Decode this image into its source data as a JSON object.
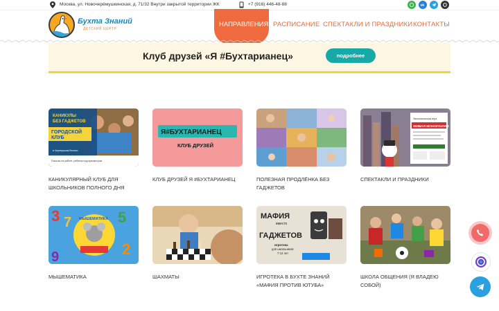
{
  "topbar": {
    "address": "Москва, ул. Новочерёмушкинская, д. 71/32 Внутри закрытой территории ЖК",
    "phone": "+7 (916) 446-48-88",
    "social": [
      {
        "icon": "whatsapp-icon",
        "color": "#3fb44a"
      },
      {
        "icon": "vk-icon",
        "color": "#2a7fd4"
      },
      {
        "icon": "telegram-icon",
        "color": "#2aa0de"
      },
      {
        "icon": "max-icon",
        "color": "#333333"
      }
    ]
  },
  "logo": {
    "title": "Бухта Знаний",
    "subtitle": "ДЕТСКИЙ ЦЕНТР"
  },
  "nav": {
    "items": [
      {
        "label": "НАПРАВЛЕНИЯ",
        "active": true
      },
      {
        "label": "РАСПИСАНИЕ",
        "active": false
      },
      {
        "label": "СПЕКТАКЛИ И ПРАЗДНИКИ",
        "active": false
      },
      {
        "label": "КОНТАКТЫ",
        "active": false
      }
    ],
    "accent_color": "#ef6a3e"
  },
  "banner": {
    "title": "Клуб друзей «Я #Бухтарианец»",
    "button_label": "подробнее"
  },
  "cards": [
    {
      "caption": "КАНИКУЛЯРНЫЙ КЛУБ ДЛЯ ШКОЛЬНИКОВ ПОЛНОГО ДНЯ",
      "thumb": {
        "line1": "КАНИКУЛЫ",
        "line2": "БЕЗ ГАДЖЕТОВ",
        "line3": "ГОРОДСКОЙ",
        "line4": "КЛУБ",
        "tag": "в Черемушках/Зюзино",
        "note": "Пока вы на работе, ребенок под присмотром"
      }
    },
    {
      "caption": "КЛУБ ДРУЗЕЙ Я #БУХТАРИАНЕЦ",
      "thumb": {
        "line1": "Я#БУХТАРИАНЕЦ",
        "line2": "КЛУБ ДРУЗЕЙ"
      }
    },
    {
      "caption": "ПОЛЕЗНАЯ ПРОДЛЁНКА БЕЗ ГАДЖЕТОВ",
      "thumb": {}
    },
    {
      "caption": "СПЕКТАКЛИ И ПРАЗДНИКИ",
      "thumb": {
        "line1": "Экономическая игра",
        "line2": "ЖИВАЯ МОНОПОЛИЯ"
      }
    },
    {
      "caption": "МЫШЕМАТИКА",
      "thumb": {
        "line1": "МЫШЕМАТИКА"
      }
    },
    {
      "caption": "ШАХМАТЫ",
      "thumb": {}
    },
    {
      "caption": "ИГРОТЕКА В БУХТЕ ЗНАНИЙ «МАФИЯ ПРОТИВ ЮТУБА»",
      "thumb": {
        "line1": "МАФИЯ",
        "line2": "вместо",
        "line3": "ГАДЖЕТОВ",
        "line4": "игротека",
        "line5": "для школьников",
        "line6": "7-12 лет"
      }
    },
    {
      "caption": "ШКОЛА ОБЩЕНИЯ (Я ВЛАДЕЮ СОБОЙ)",
      "thumb": {}
    }
  ],
  "floating": [
    {
      "icon": "phone-icon",
      "color": "#f06a6a"
    },
    {
      "icon": "chat-icon",
      "color": "#6a3fd0"
    },
    {
      "icon": "telegram-icon",
      "color": "#2aa0de"
    }
  ]
}
